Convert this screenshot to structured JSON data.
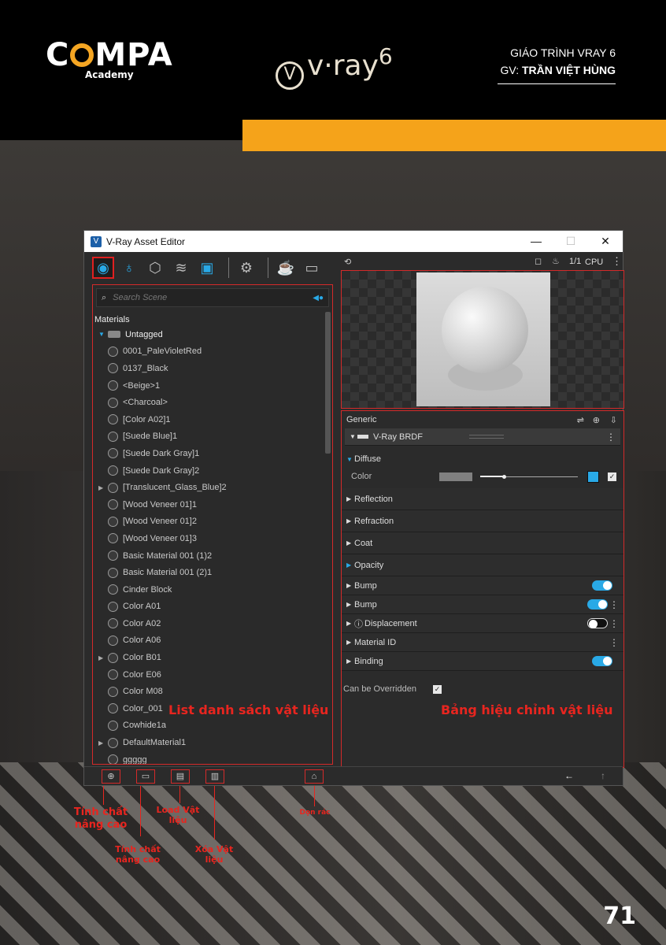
{
  "header": {
    "brand": "C",
    "brand_rest": "MPA",
    "brand_sub": "Academy",
    "product": "v·ray",
    "product_version": "6",
    "course_title": "GIÁO TRÌNH VRAY 6",
    "teacher_prefix": "GV:",
    "teacher_name": "TRẦN VIỆT HÙNG"
  },
  "window": {
    "title": "V-Ray Asset Editor",
    "controls": {
      "minimize": "—",
      "maximize": "☐",
      "close": "✕"
    }
  },
  "left_toolbar": {
    "icons": [
      "materials-icon",
      "lights-icon",
      "geometry-icon",
      "layers-icon",
      "render-elements-icon",
      "settings-icon",
      "teapot-icon",
      "frame-buffer-icon"
    ]
  },
  "search": {
    "placeholder": "Search Scene"
  },
  "materials": {
    "header": "Materials",
    "tag": "Untagged",
    "items": [
      {
        "name": "0001_PaleVioletRed",
        "expandable": false
      },
      {
        "name": "0137_Black",
        "expandable": false
      },
      {
        "name": "<Beige>1",
        "expandable": false
      },
      {
        "name": "<Charcoal>",
        "expandable": false
      },
      {
        "name": "[Color A02]1",
        "expandable": false
      },
      {
        "name": "[Suede Blue]1",
        "expandable": false
      },
      {
        "name": "[Suede Dark Gray]1",
        "expandable": false
      },
      {
        "name": "[Suede Dark Gray]2",
        "expandable": false
      },
      {
        "name": "[Translucent_Glass_Blue]2",
        "expandable": true
      },
      {
        "name": "[Wood Veneer 01]1",
        "expandable": false
      },
      {
        "name": "[Wood Veneer 01]2",
        "expandable": false
      },
      {
        "name": "[Wood Veneer 01]3",
        "expandable": false
      },
      {
        "name": "Basic Material 001 (1)2",
        "expandable": false
      },
      {
        "name": "Basic Material 001 (2)1",
        "expandable": false
      },
      {
        "name": "Cinder Block",
        "expandable": false
      },
      {
        "name": "Color A01",
        "expandable": false
      },
      {
        "name": "Color A02",
        "expandable": false
      },
      {
        "name": "Color A06",
        "expandable": false
      },
      {
        "name": "Color B01",
        "expandable": true
      },
      {
        "name": "Color E06",
        "expandable": false
      },
      {
        "name": "Color M08",
        "expandable": false
      },
      {
        "name": "Color_001",
        "expandable": false
      },
      {
        "name": "Cowhide1a",
        "expandable": false
      },
      {
        "name": "DefaultMaterial1",
        "expandable": true
      },
      {
        "name": "ggggg",
        "expandable": false
      }
    ]
  },
  "right_toolbar": {
    "fraction": "1/1",
    "device": "CPU"
  },
  "props": {
    "generic_label": "Generic",
    "brdf_label": "V-Ray BRDF",
    "diffuse_label": "Diffuse",
    "color_label": "Color",
    "sections": [
      {
        "label": "Reflection",
        "toggle": null,
        "menu": false,
        "blue": false
      },
      {
        "label": "Refraction",
        "toggle": null,
        "menu": false,
        "blue": false
      },
      {
        "label": "Coat",
        "toggle": null,
        "menu": false,
        "blue": false
      },
      {
        "label": "Opacity",
        "toggle": null,
        "menu": false,
        "blue": true
      },
      {
        "label": "Bump",
        "toggle": "on",
        "menu": false,
        "blue": false
      },
      {
        "label": "Bump",
        "toggle": "on",
        "menu": true,
        "blue": false
      },
      {
        "label": "Displacement",
        "toggle": "off",
        "menu": true,
        "blue": false
      },
      {
        "label": "Material ID",
        "toggle": null,
        "menu": true,
        "blue": false
      },
      {
        "label": "Binding",
        "toggle": "on",
        "menu": false,
        "blue": false
      }
    ],
    "override_label": "Can be Overridden",
    "override_checked": true
  },
  "annotations": {
    "list_label": "List danh sách vật liệu",
    "props_label": "Bảng hiệu chỉnh vật liệu",
    "advanced_1": "Tính chất nâng cao",
    "advanced_2": "Tính chất nâng cao",
    "load": "Load Vật liệu",
    "delete": "Xóa Vật liệu",
    "purge": "Dọn rác"
  },
  "page_number": "71",
  "colors": {
    "accent": "#f5a31a",
    "highlight": "#e8251f",
    "vray_blue": "#29a9e6"
  }
}
